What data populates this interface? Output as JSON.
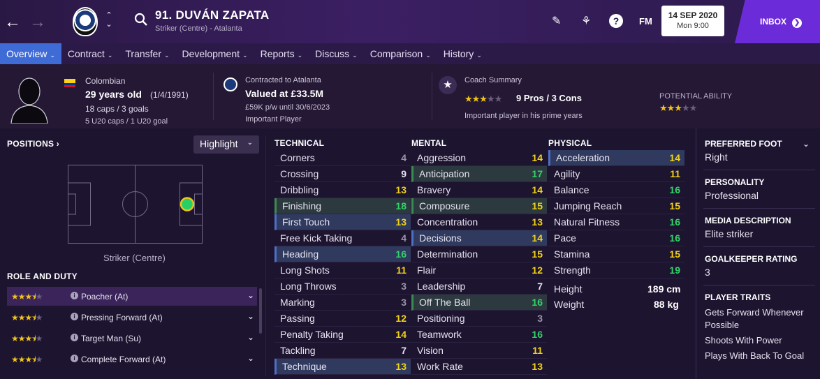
{
  "header": {
    "player_name": "91. DUVÁN ZAPATA",
    "player_sub": "Striker (Centre) - Atalanta",
    "fm_label": "FM",
    "date": "14 SEP 2020",
    "time": "Mon 9:00",
    "inbox_label": "INBOX",
    "help_label": "?"
  },
  "tabs": [
    {
      "label": "Overview"
    },
    {
      "label": "Contract"
    },
    {
      "label": "Transfer"
    },
    {
      "label": "Development"
    },
    {
      "label": "Reports"
    },
    {
      "label": "Discuss"
    },
    {
      "label": "Comparison"
    },
    {
      "label": "History"
    }
  ],
  "summary": {
    "nationality": "Colombian",
    "age": "29 years old",
    "dob": "(1/4/1991)",
    "caps": "18 caps / 3 goals",
    "u20": "5 U20 caps / 1 U20 goal",
    "contract_title": "Contracted to Atalanta",
    "value": "Valued at £33.5M",
    "wage": "£59K p/w until 30/6/2023",
    "status": "Important Player",
    "coach_title": "Coach Summary",
    "coach_rating": 3.5,
    "pros_cons": "9 Pros / 3 Cons",
    "coach_note": "Important player in his prime years",
    "potential_title": "POTENTIAL ABILITY",
    "potential_rating": 3.5
  },
  "positions": {
    "title": "POSITIONS",
    "highlight_label": "Highlight",
    "position_label": "Striker (Centre)"
  },
  "roles": {
    "title": "ROLE AND DUTY",
    "items": [
      {
        "name": "Poacher (At)",
        "rating": 3.5
      },
      {
        "name": "Pressing Forward (At)",
        "rating": 3.5
      },
      {
        "name": "Target Man (Su)",
        "rating": 3.5
      },
      {
        "name": "Complete Forward (At)",
        "rating": 3.5
      }
    ]
  },
  "technical": {
    "title": "TECHNICAL",
    "items": [
      {
        "name": "Corners",
        "value": "4",
        "hl": ""
      },
      {
        "name": "Crossing",
        "value": "9",
        "hl": ""
      },
      {
        "name": "Dribbling",
        "value": "13",
        "hl": ""
      },
      {
        "name": "Finishing",
        "value": "18",
        "hl": "hl2"
      },
      {
        "name": "First Touch",
        "value": "13",
        "hl": "hl"
      },
      {
        "name": "Free Kick Taking",
        "value": "4",
        "hl": ""
      },
      {
        "name": "Heading",
        "value": "16",
        "hl": "hl"
      },
      {
        "name": "Long Shots",
        "value": "11",
        "hl": ""
      },
      {
        "name": "Long Throws",
        "value": "3",
        "hl": ""
      },
      {
        "name": "Marking",
        "value": "3",
        "hl": ""
      },
      {
        "name": "Passing",
        "value": "12",
        "hl": ""
      },
      {
        "name": "Penalty Taking",
        "value": "14",
        "hl": ""
      },
      {
        "name": "Tackling",
        "value": "7",
        "hl": ""
      },
      {
        "name": "Technique",
        "value": "13",
        "hl": "hl"
      }
    ]
  },
  "mental": {
    "title": "MENTAL",
    "items": [
      {
        "name": "Aggression",
        "value": "14",
        "hl": ""
      },
      {
        "name": "Anticipation",
        "value": "17",
        "hl": "hl2"
      },
      {
        "name": "Bravery",
        "value": "14",
        "hl": ""
      },
      {
        "name": "Composure",
        "value": "15",
        "hl": "hl2"
      },
      {
        "name": "Concentration",
        "value": "13",
        "hl": ""
      },
      {
        "name": "Decisions",
        "value": "14",
        "hl": "hl"
      },
      {
        "name": "Determination",
        "value": "15",
        "hl": ""
      },
      {
        "name": "Flair",
        "value": "12",
        "hl": ""
      },
      {
        "name": "Leadership",
        "value": "7",
        "hl": ""
      },
      {
        "name": "Off The Ball",
        "value": "16",
        "hl": "hl2"
      },
      {
        "name": "Positioning",
        "value": "3",
        "hl": ""
      },
      {
        "name": "Teamwork",
        "value": "16",
        "hl": ""
      },
      {
        "name": "Vision",
        "value": "11",
        "hl": ""
      },
      {
        "name": "Work Rate",
        "value": "13",
        "hl": ""
      }
    ]
  },
  "physical": {
    "title": "PHYSICAL",
    "items": [
      {
        "name": "Acceleration",
        "value": "14",
        "hl": "hl"
      },
      {
        "name": "Agility",
        "value": "11",
        "hl": ""
      },
      {
        "name": "Balance",
        "value": "16",
        "hl": ""
      },
      {
        "name": "Jumping Reach",
        "value": "15",
        "hl": ""
      },
      {
        "name": "Natural Fitness",
        "value": "16",
        "hl": ""
      },
      {
        "name": "Pace",
        "value": "16",
        "hl": ""
      },
      {
        "name": "Stamina",
        "value": "15",
        "hl": ""
      },
      {
        "name": "Strength",
        "value": "19",
        "hl": ""
      }
    ],
    "height_label": "Height",
    "height_value": "189 cm",
    "weight_label": "Weight",
    "weight_value": "88 kg"
  },
  "info": {
    "foot_title": "PREFERRED FOOT",
    "foot_value": "Right",
    "personality_title": "PERSONALITY",
    "personality_value": "Professional",
    "media_title": "MEDIA DESCRIPTION",
    "media_value": "Elite striker",
    "gk_title": "GOALKEEPER RATING",
    "gk_value": "3",
    "traits_title": "PLAYER TRAITS",
    "traits": [
      "Gets Forward Whenever",
      "Possible",
      "Shoots With Power",
      "Plays With Back To Goal"
    ]
  },
  "colors": {
    "accent": "#3f6bd6",
    "inbox": "#6c2bd9",
    "star": "#f0c419",
    "attr_high": "#33d36a",
    "attr_good": "#f0d21a"
  }
}
